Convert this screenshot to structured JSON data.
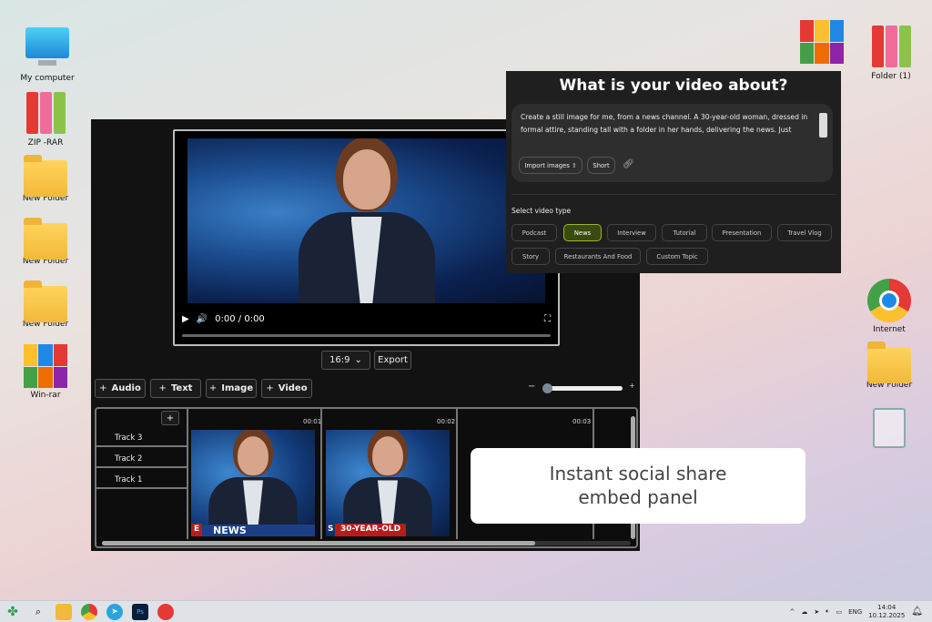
{
  "desktop": {
    "left_icons": [
      "My computer",
      "ZIP -RAR",
      "New Folder",
      "New Folder",
      "New Folder",
      "Win-rar"
    ],
    "right_icons": [
      "Folder (1)",
      "Internet",
      "New Folder"
    ]
  },
  "player": {
    "time": "0:00 / 0:00"
  },
  "editor": {
    "aspect": "16:9",
    "export": "Export",
    "add_buttons": [
      "Audio",
      "Text",
      "Image",
      "Video"
    ],
    "tracks": [
      "Track 3",
      "Track 2",
      "Track 1"
    ],
    "timestamps": [
      "00:01",
      "00:02",
      "00:03"
    ],
    "clips": [
      {
        "caption_prefix": "E",
        "caption": "NEWS"
      },
      {
        "caption_prefix": "S",
        "caption": "30-YEAR-OLD"
      }
    ]
  },
  "prompt": {
    "title": "What is your video about?",
    "text": "Create a still image for me, from a news channel. A 30-year-old woman, dressed in formal attire, standing tall with a folder in her hands, delivering the news. Just",
    "import": "Import images",
    "short": "Short",
    "select_label": "Select video type",
    "types": [
      "Podcast",
      "News",
      "Interview",
      "Tutorial",
      "Presentation",
      "Travel Vlog",
      "Story",
      "Restaurants And Food",
      "Custom Topic"
    ],
    "selected": "News"
  },
  "toast": {
    "line1": "Instant social share",
    "line2": "embed panel"
  },
  "taskbar": {
    "lang": "ENG",
    "time": "14:04",
    "date": "10.12.2025"
  },
  "colors": {
    "accent": "#3b4a10",
    "accent_border": "#9bb52a"
  }
}
